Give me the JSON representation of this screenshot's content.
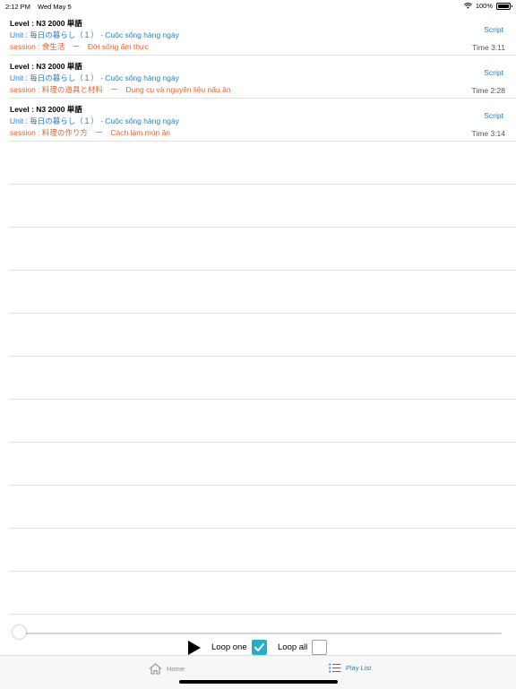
{
  "status_bar": {
    "time": "2:12 PM",
    "date": "Wed May 5",
    "battery": "100%",
    "icons": [
      "wifi-icon",
      "battery-icon"
    ]
  },
  "items": [
    {
      "level": "Level : N3 2000 単語",
      "unit": "Unit : 毎日の暮らし（１） - Cuộc sống hàng ngày",
      "session": "session : 食生活　ー　Đời sống ẩm thực",
      "script": "Script",
      "time": "Time 3:11"
    },
    {
      "level": "Level : N3 2000 単語",
      "unit": "Unit : 毎日の暮らし（１） - Cuộc sống hàng ngày",
      "session": "session : 料理の道具と材料　ー　Dụng cụ và nguyên liệu nấu ăn",
      "script": "Script",
      "time": "Time 2:28"
    },
    {
      "level": "Level : N3 2000 単語",
      "unit": "Unit : 毎日の暮らし（１） - Cuộc sống hàng ngày",
      "session": "session : 料理の作り方　ー　Cách làm món ăn",
      "script": "Script",
      "time": "Time 3:14"
    }
  ],
  "player": {
    "progress": 0,
    "loop_one_label": "Loop one",
    "loop_one_checked": true,
    "loop_all_label": "Loop all",
    "loop_all_checked": false,
    "accent_color": "#25aec7"
  },
  "tabbar": {
    "home_label": "Home",
    "playlist_label": "Play List",
    "active_tab": "Play List",
    "active_color": "#1a7fd4"
  }
}
